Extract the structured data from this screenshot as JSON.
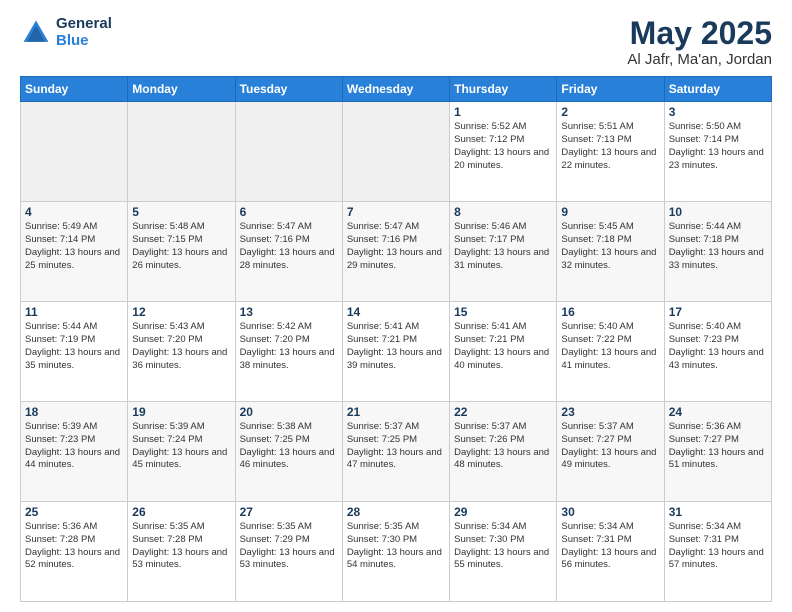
{
  "header": {
    "logo_general": "General",
    "logo_blue": "Blue",
    "title": "May 2025",
    "location": "Al Jafr, Ma'an, Jordan"
  },
  "weekdays": [
    "Sunday",
    "Monday",
    "Tuesday",
    "Wednesday",
    "Thursday",
    "Friday",
    "Saturday"
  ],
  "weeks": [
    [
      {
        "day": "",
        "empty": true
      },
      {
        "day": "",
        "empty": true
      },
      {
        "day": "",
        "empty": true
      },
      {
        "day": "",
        "empty": true
      },
      {
        "day": "1",
        "sunrise": "5:52 AM",
        "sunset": "7:12 PM",
        "daylight": "13 hours and 20 minutes."
      },
      {
        "day": "2",
        "sunrise": "5:51 AM",
        "sunset": "7:13 PM",
        "daylight": "13 hours and 22 minutes."
      },
      {
        "day": "3",
        "sunrise": "5:50 AM",
        "sunset": "7:14 PM",
        "daylight": "13 hours and 23 minutes."
      }
    ],
    [
      {
        "day": "4",
        "sunrise": "5:49 AM",
        "sunset": "7:14 PM",
        "daylight": "13 hours and 25 minutes."
      },
      {
        "day": "5",
        "sunrise": "5:48 AM",
        "sunset": "7:15 PM",
        "daylight": "13 hours and 26 minutes."
      },
      {
        "day": "6",
        "sunrise": "5:47 AM",
        "sunset": "7:16 PM",
        "daylight": "13 hours and 28 minutes."
      },
      {
        "day": "7",
        "sunrise": "5:47 AM",
        "sunset": "7:16 PM",
        "daylight": "13 hours and 29 minutes."
      },
      {
        "day": "8",
        "sunrise": "5:46 AM",
        "sunset": "7:17 PM",
        "daylight": "13 hours and 31 minutes."
      },
      {
        "day": "9",
        "sunrise": "5:45 AM",
        "sunset": "7:18 PM",
        "daylight": "13 hours and 32 minutes."
      },
      {
        "day": "10",
        "sunrise": "5:44 AM",
        "sunset": "7:18 PM",
        "daylight": "13 hours and 33 minutes."
      }
    ],
    [
      {
        "day": "11",
        "sunrise": "5:44 AM",
        "sunset": "7:19 PM",
        "daylight": "13 hours and 35 minutes."
      },
      {
        "day": "12",
        "sunrise": "5:43 AM",
        "sunset": "7:20 PM",
        "daylight": "13 hours and 36 minutes."
      },
      {
        "day": "13",
        "sunrise": "5:42 AM",
        "sunset": "7:20 PM",
        "daylight": "13 hours and 38 minutes."
      },
      {
        "day": "14",
        "sunrise": "5:41 AM",
        "sunset": "7:21 PM",
        "daylight": "13 hours and 39 minutes."
      },
      {
        "day": "15",
        "sunrise": "5:41 AM",
        "sunset": "7:21 PM",
        "daylight": "13 hours and 40 minutes."
      },
      {
        "day": "16",
        "sunrise": "5:40 AM",
        "sunset": "7:22 PM",
        "daylight": "13 hours and 41 minutes."
      },
      {
        "day": "17",
        "sunrise": "5:40 AM",
        "sunset": "7:23 PM",
        "daylight": "13 hours and 43 minutes."
      }
    ],
    [
      {
        "day": "18",
        "sunrise": "5:39 AM",
        "sunset": "7:23 PM",
        "daylight": "13 hours and 44 minutes."
      },
      {
        "day": "19",
        "sunrise": "5:39 AM",
        "sunset": "7:24 PM",
        "daylight": "13 hours and 45 minutes."
      },
      {
        "day": "20",
        "sunrise": "5:38 AM",
        "sunset": "7:25 PM",
        "daylight": "13 hours and 46 minutes."
      },
      {
        "day": "21",
        "sunrise": "5:37 AM",
        "sunset": "7:25 PM",
        "daylight": "13 hours and 47 minutes."
      },
      {
        "day": "22",
        "sunrise": "5:37 AM",
        "sunset": "7:26 PM",
        "daylight": "13 hours and 48 minutes."
      },
      {
        "day": "23",
        "sunrise": "5:37 AM",
        "sunset": "7:27 PM",
        "daylight": "13 hours and 49 minutes."
      },
      {
        "day": "24",
        "sunrise": "5:36 AM",
        "sunset": "7:27 PM",
        "daylight": "13 hours and 51 minutes."
      }
    ],
    [
      {
        "day": "25",
        "sunrise": "5:36 AM",
        "sunset": "7:28 PM",
        "daylight": "13 hours and 52 minutes."
      },
      {
        "day": "26",
        "sunrise": "5:35 AM",
        "sunset": "7:28 PM",
        "daylight": "13 hours and 53 minutes."
      },
      {
        "day": "27",
        "sunrise": "5:35 AM",
        "sunset": "7:29 PM",
        "daylight": "13 hours and 53 minutes."
      },
      {
        "day": "28",
        "sunrise": "5:35 AM",
        "sunset": "7:30 PM",
        "daylight": "13 hours and 54 minutes."
      },
      {
        "day": "29",
        "sunrise": "5:34 AM",
        "sunset": "7:30 PM",
        "daylight": "13 hours and 55 minutes."
      },
      {
        "day": "30",
        "sunrise": "5:34 AM",
        "sunset": "7:31 PM",
        "daylight": "13 hours and 56 minutes."
      },
      {
        "day": "31",
        "sunrise": "5:34 AM",
        "sunset": "7:31 PM",
        "daylight": "13 hours and 57 minutes."
      }
    ]
  ]
}
